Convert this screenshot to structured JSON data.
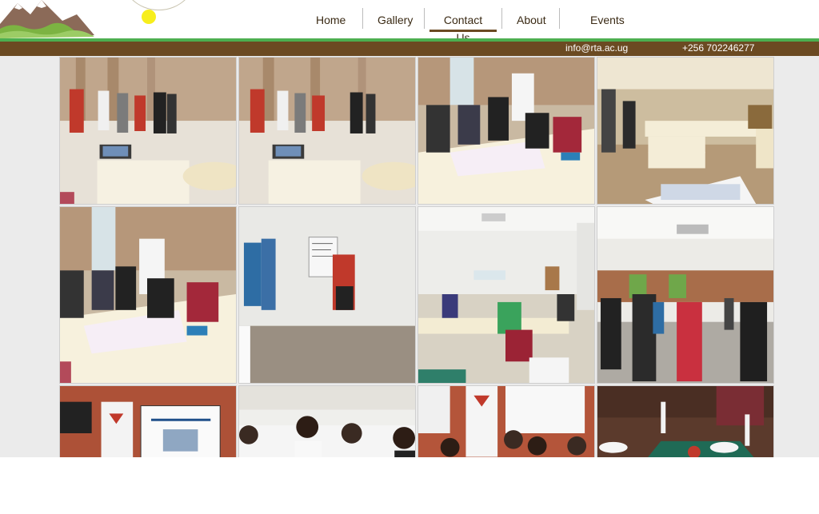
{
  "nav": {
    "items": [
      {
        "label": "Home"
      },
      {
        "label": "Gallery"
      },
      {
        "label": "Contact Us",
        "active": true
      },
      {
        "label": "About"
      },
      {
        "label": "Events"
      }
    ]
  },
  "contact": {
    "email": "info@rta.ac.ug",
    "phone": "+256 702246277"
  },
  "colors": {
    "accent_green": "#4caf50",
    "brand_brown": "#6b4a22",
    "sun_yellow": "#f7ee1c"
  },
  "gallery": {
    "photos": [
      {
        "scene": "workshop-presentation"
      },
      {
        "scene": "workshop-presentation"
      },
      {
        "scene": "group-writing"
      },
      {
        "scene": "conference-room"
      },
      {
        "scene": "group-writing"
      },
      {
        "scene": "flipchart-presenter"
      },
      {
        "scene": "training-hall"
      },
      {
        "scene": "standing-group"
      },
      {
        "scene": "projector-slide"
      },
      {
        "scene": "smiling-group"
      },
      {
        "scene": "banner-group"
      },
      {
        "scene": "dinner-table"
      }
    ]
  }
}
